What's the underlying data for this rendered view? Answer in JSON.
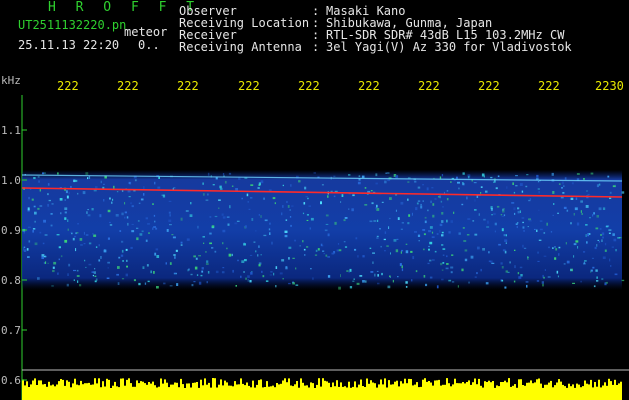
{
  "header": {
    "station": "H R O F F T",
    "file_name": "UT2511132220.pn",
    "file_tag": "meteor",
    "date_time": "25.11.13 22:20",
    "date_extra": "0..",
    "observer_label": "Observer",
    "observer_value": "Masaki Kano",
    "location_label": "Receiving Location",
    "location_value": "Shibukawa, Gunma, Japan",
    "receiver_label": "Receiver",
    "receiver_value": "RTL-SDR SDR# 43dB L15 103.2MHz CW",
    "antenna_label": "Receiving Antenna",
    "antenna_value": "3el Yagi(V) Az 330 for Vladivostok",
    "separator": ":"
  },
  "axis": {
    "unit": "kHz",
    "y_ticks": [
      "1.1",
      "1.0",
      "0.9",
      "0.8",
      "0.7",
      "0.6"
    ],
    "time_labels": [
      "222",
      "222",
      "222",
      "222",
      "222",
      "222",
      "222",
      "222",
      "222",
      "2230"
    ]
  },
  "colors": {
    "background": "#000000",
    "label_green": "#2fd02f",
    "text_white": "#e6e6e6",
    "time_yellow": "#e8e800",
    "carrier_red": "#ff2a2a",
    "noise_yellow": "#ffff00"
  }
}
